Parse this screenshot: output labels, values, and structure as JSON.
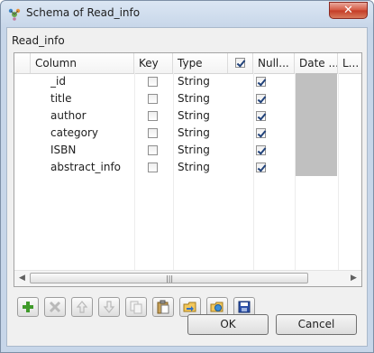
{
  "window": {
    "title": "Schema of Read_info",
    "close_glyph": "✕"
  },
  "schema_name": "Read_info",
  "table": {
    "headers": {
      "column": "Column",
      "key": "Key",
      "type": "Type",
      "nullable": "Null...",
      "date_pattern": "Date ...",
      "length": "L..."
    },
    "header_checkbox_checked": true,
    "rows": [
      {
        "column": "_id",
        "key": false,
        "type": "String",
        "nullable": true
      },
      {
        "column": "title",
        "key": false,
        "type": "String",
        "nullable": true
      },
      {
        "column": "author",
        "key": false,
        "type": "String",
        "nullable": true
      },
      {
        "column": "category",
        "key": false,
        "type": "String",
        "nullable": true
      },
      {
        "column": "ISBN",
        "key": false,
        "type": "String",
        "nullable": true
      },
      {
        "column": "abstract_info",
        "key": false,
        "type": "String",
        "nullable": true
      }
    ],
    "scroll": {
      "left_arrow": "◀",
      "right_arrow": "▶",
      "grip": "|||"
    }
  },
  "toolbar": [
    {
      "name": "add-button",
      "icon": "plus-icon",
      "enabled": true
    },
    {
      "name": "remove-button",
      "icon": "x-icon",
      "enabled": false
    },
    {
      "name": "move-up-button",
      "icon": "arrow-up-icon",
      "enabled": false
    },
    {
      "name": "move-down-button",
      "icon": "arrow-down-icon",
      "enabled": false
    },
    {
      "name": "copy-button",
      "icon": "copy-icon",
      "enabled": false
    },
    {
      "name": "paste-button",
      "icon": "paste-icon",
      "enabled": true
    },
    {
      "name": "import-button",
      "icon": "import-folder-icon",
      "enabled": true
    },
    {
      "name": "export-button",
      "icon": "export-folder-icon",
      "enabled": true
    },
    {
      "name": "save-button",
      "icon": "save-icon",
      "enabled": true
    }
  ],
  "buttons": {
    "ok": "OK",
    "cancel": "Cancel"
  },
  "colors": {
    "accent_green": "#3f9a2a",
    "checkmark": "#21427a",
    "disabled_cell": "#c0c0c0",
    "close_red": "#c43b26"
  }
}
